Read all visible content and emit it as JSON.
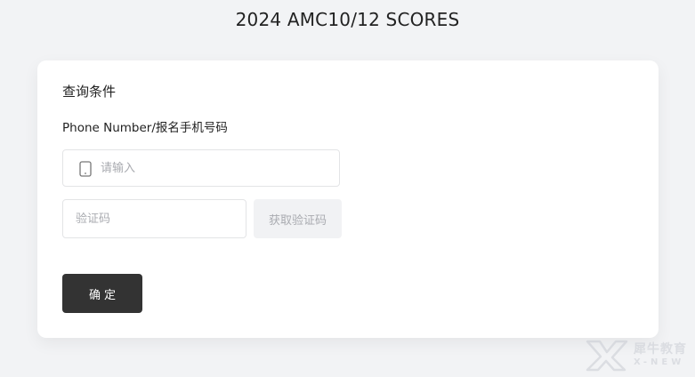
{
  "page": {
    "title": "2024 AMC10/12 SCORES"
  },
  "card": {
    "section_title": "查询条件",
    "phone": {
      "label": "Phone Number/报名手机号码",
      "placeholder": "请输入",
      "value": "",
      "icon": "mobile-phone-icon"
    },
    "code": {
      "placeholder": "验证码",
      "value": "",
      "get_code_label": "获取验证码"
    },
    "confirm_label": "确定"
  },
  "watermark": {
    "text": "犀牛教育",
    "sub": "X-NEW"
  }
}
